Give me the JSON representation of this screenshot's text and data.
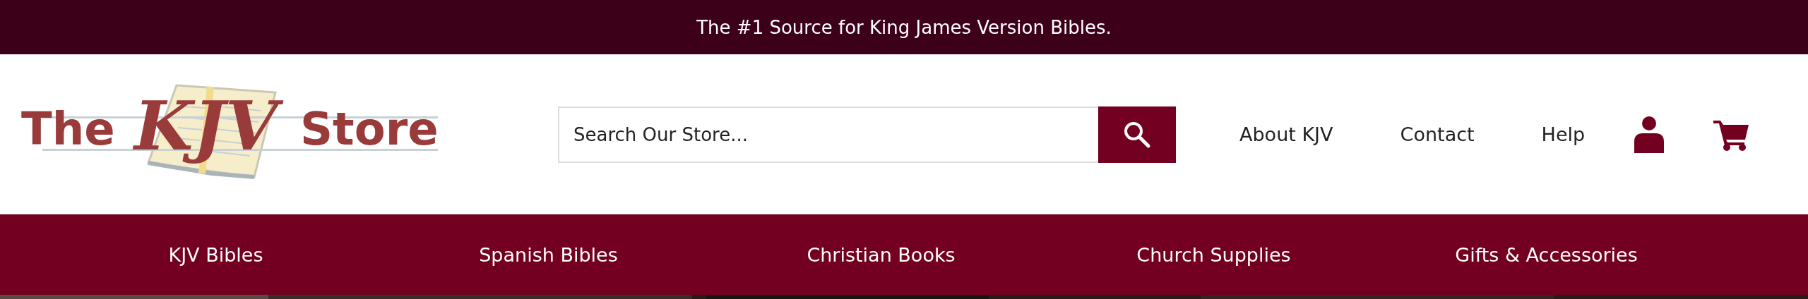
{
  "announcement": "The #1 Source for King James Version Bibles.",
  "logo": {
    "word_1": "The",
    "word_2": "KJV",
    "word_3": "Store"
  },
  "search": {
    "placeholder": "Search Our Store..."
  },
  "header_links": [
    "About KJV",
    "Contact",
    "Help"
  ],
  "nav": [
    "KJV Bibles",
    "Spanish Bibles",
    "Christian Books",
    "Church Supplies",
    "Gifts & Accessories"
  ]
}
